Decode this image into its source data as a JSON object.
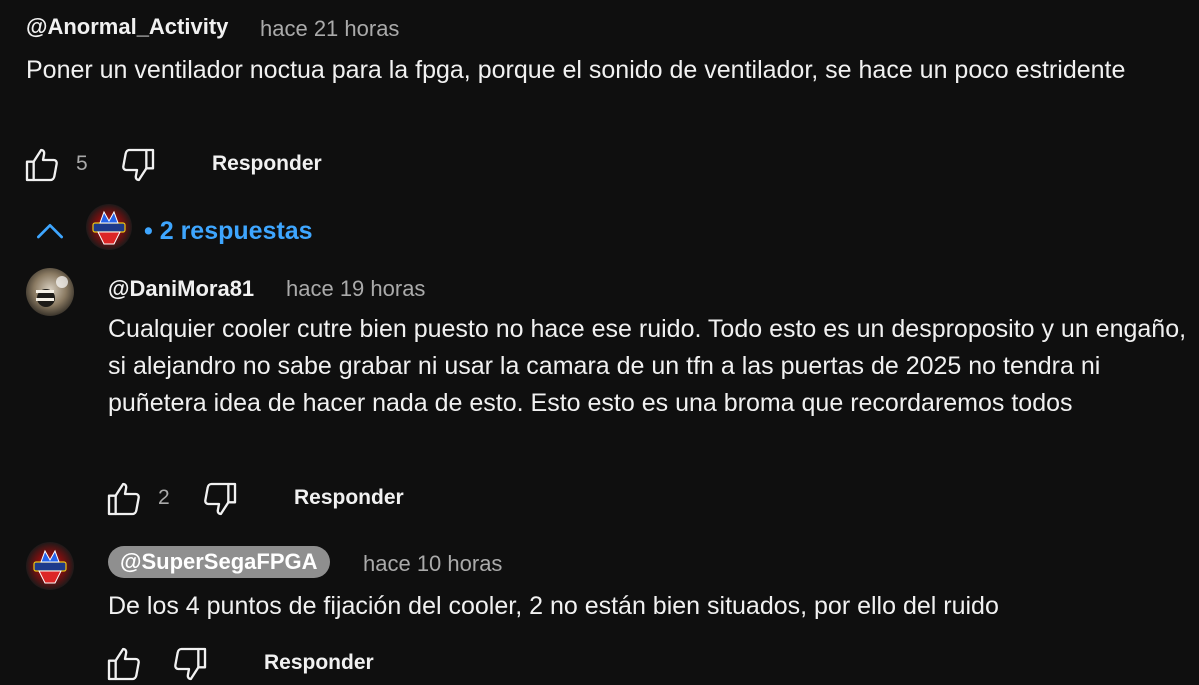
{
  "comment": {
    "author": "@Anormal_Activity",
    "time": "hace 21 horas",
    "text": "Poner un ventilador noctua para la fpga, porque el sonido de ventilador, se hace un poco estridente",
    "likes": "5",
    "reply_label": "Responder"
  },
  "replies_toggle": {
    "label": "2 respuestas",
    "bullet": "•"
  },
  "replies": [
    {
      "author": "@DaniMora81",
      "time": "hace 19 horas",
      "text": "Cualquier cooler cutre bien puesto no hace ese ruido. Todo esto es un desproposito y un engaño, si alejandro no sabe grabar ni usar la camara de un tfn a las puertas de 2025 no tendra ni puñetera idea de hacer nada de esto. Esto esto es una broma que recordaremos todos",
      "likes": "2",
      "reply_label": "Responder"
    },
    {
      "author": "@SuperSegaFPGA",
      "time": "hace 10 horas",
      "text": "De los 4 puntos de fijación del cooler, 2 no están bien situados, por ello del ruido",
      "reply_label": "Responder"
    }
  ],
  "colors": {
    "background": "#0f0f0f",
    "text": "#f1f1f1",
    "muted": "#aaaaaa",
    "link": "#3ea6ff",
    "creator_pill": "#8f8f8f"
  },
  "icons": [
    "thumb-up-icon",
    "thumb-down-icon",
    "chevron-up-icon"
  ]
}
